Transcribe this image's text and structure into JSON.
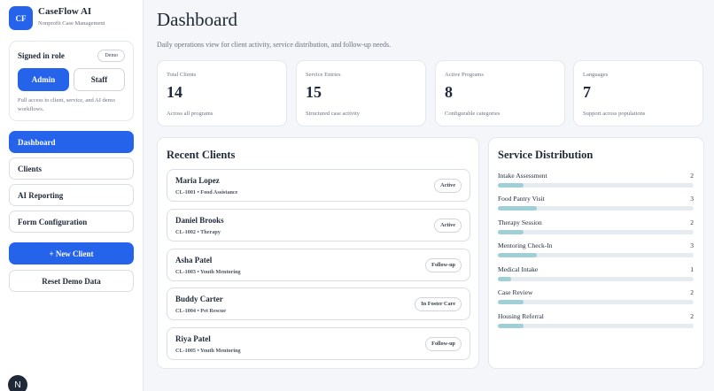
{
  "brand": {
    "logo": "CF",
    "name": "CaseFlow AI",
    "subtitle": "Nonprofit Case Management"
  },
  "role": {
    "title": "Signed in role",
    "badge": "Demo",
    "admin_label": "Admin",
    "staff_label": "Staff",
    "selected": "Admin",
    "description": "Full access to client, service, and AI demo workflows."
  },
  "nav": [
    {
      "label": "Dashboard",
      "active": true
    },
    {
      "label": "Clients",
      "active": false
    },
    {
      "label": "AI Reporting",
      "active": false
    },
    {
      "label": "Form Configuration",
      "active": false
    }
  ],
  "actions": {
    "new_client": "+ New Client",
    "reset": "Reset Demo Data"
  },
  "corner_badge": "N",
  "page": {
    "title": "Dashboard",
    "subtitle": "Daily operations view for client activity, service distribution, and follow-up needs."
  },
  "stats": [
    {
      "label": "Total Clients",
      "value": "14",
      "note": "Across all programs"
    },
    {
      "label": "Service Entries",
      "value": "15",
      "note": "Structured case activity"
    },
    {
      "label": "Active Programs",
      "value": "8",
      "note": "Configurable categories"
    },
    {
      "label": "Languages",
      "value": "7",
      "note": "Support across populations"
    }
  ],
  "recent_clients": {
    "title": "Recent Clients",
    "items": [
      {
        "name": "Maria Lopez",
        "meta": "CL-1001 • Food Assistance",
        "status": "Active"
      },
      {
        "name": "Daniel Brooks",
        "meta": "CL-1002 • Therapy",
        "status": "Active"
      },
      {
        "name": "Asha Patel",
        "meta": "CL-1003 • Youth Mentoring",
        "status": "Follow-up"
      },
      {
        "name": "Buddy Carter",
        "meta": "CL-1004 • Pet Rescue",
        "status": "In Foster Care"
      },
      {
        "name": "Riya Patel",
        "meta": "CL-1005 • Youth Mentoring",
        "status": "Follow-up"
      }
    ]
  },
  "service_distribution": {
    "title": "Service Distribution",
    "max": 15,
    "items": [
      {
        "name": "Intake Assessment",
        "count": 2
      },
      {
        "name": "Food Pantry Visit",
        "count": 3
      },
      {
        "name": "Therapy Session",
        "count": 2
      },
      {
        "name": "Mentoring Check-In",
        "count": 3
      },
      {
        "name": "Medical Intake",
        "count": 1
      },
      {
        "name": "Case Review",
        "count": 2
      },
      {
        "name": "Housing Referral",
        "count": 2
      }
    ]
  },
  "colors": {
    "accent": "#2563eb",
    "bar_fill": "#9fd0d8",
    "bar_track": "#e6ebf0"
  }
}
